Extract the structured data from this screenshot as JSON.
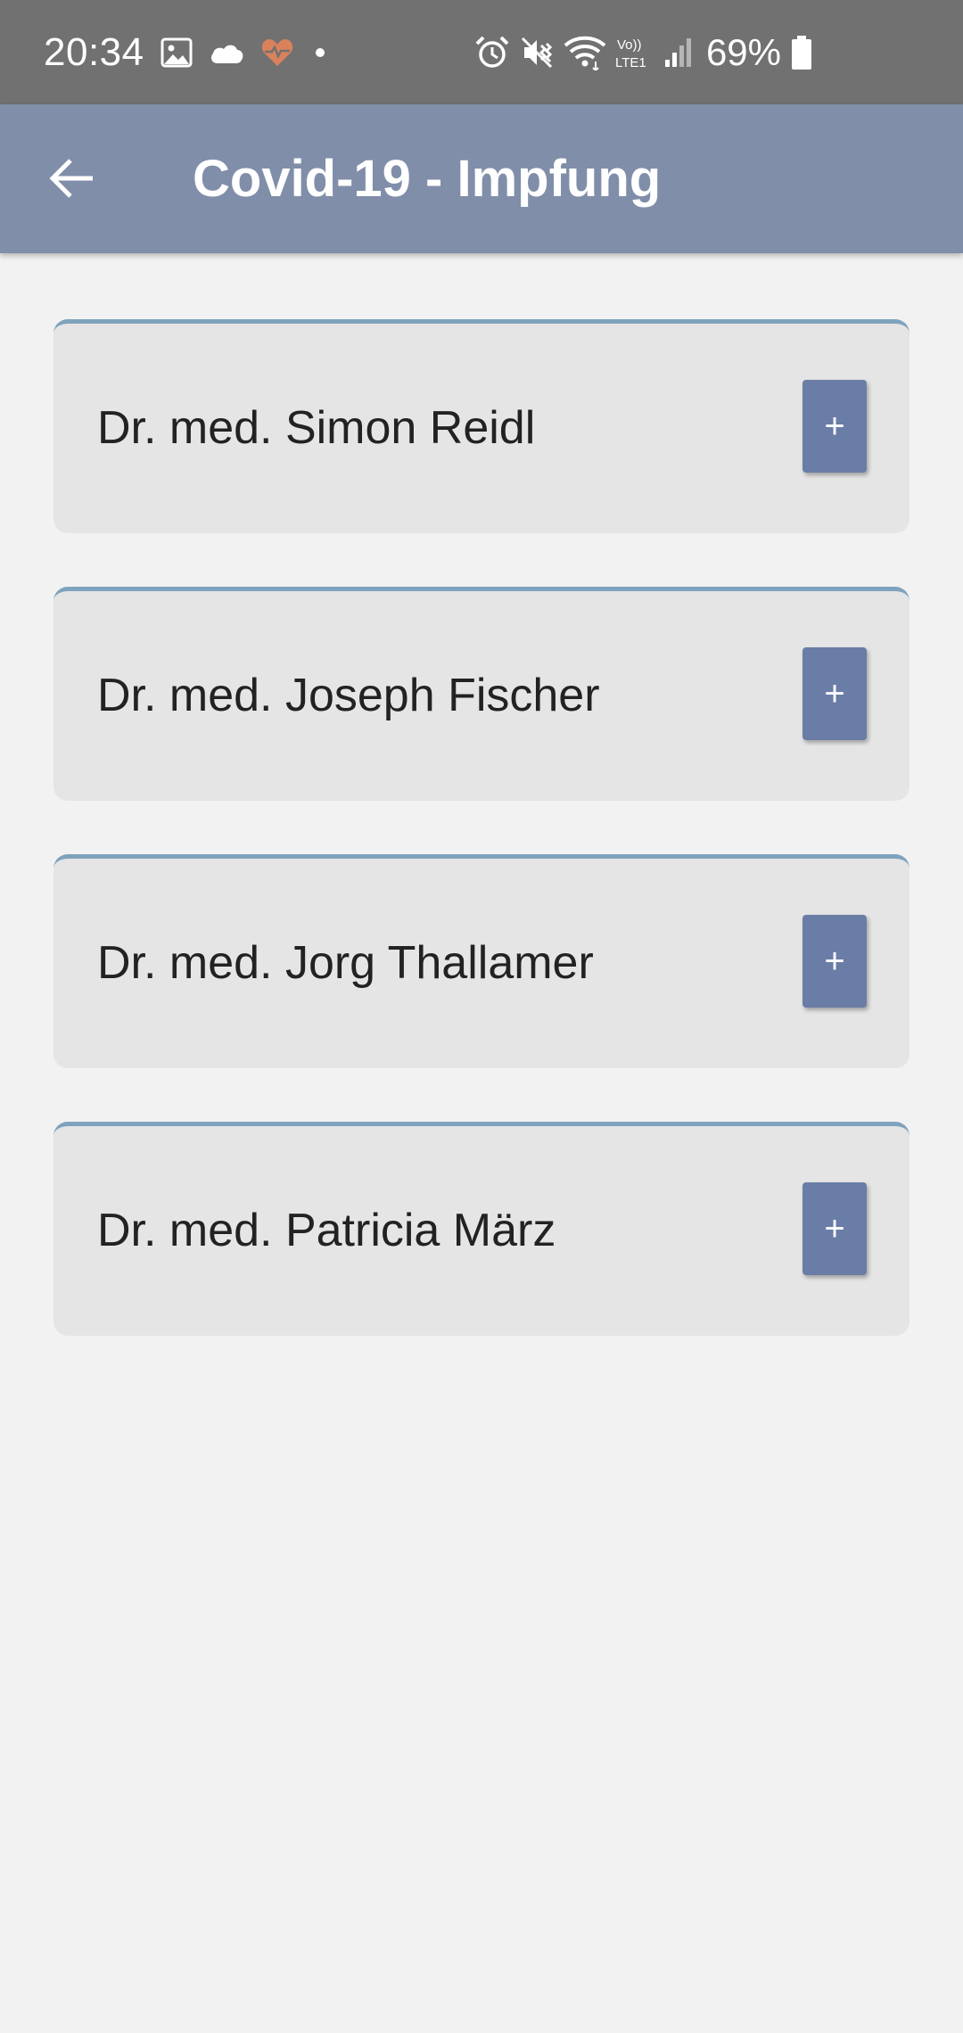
{
  "status_bar": {
    "time": "20:34",
    "battery_percent": "69%",
    "left_icons": [
      "gallery-icon",
      "cloud-icon",
      "health-heart-icon",
      "notification-dot-icon"
    ],
    "right_icons": [
      "alarm-icon",
      "vibrate-mute-icon",
      "wifi-icon",
      "volte-lte1-icon",
      "signal-icon",
      "battery-icon"
    ],
    "volte_label": "Vo)) LTE1"
  },
  "app_bar": {
    "title": "Covid-19 - Impfung",
    "back_icon": "arrow-left-icon"
  },
  "doctors": [
    {
      "name": "Dr. med. Simon Reidl",
      "action_label": "+"
    },
    {
      "name": "Dr. med. Joseph Fischer",
      "action_label": "+"
    },
    {
      "name": "Dr. med. Jorg Thallamer",
      "action_label": "+"
    },
    {
      "name": "Dr. med. Patricia März",
      "action_label": "+"
    }
  ],
  "colors": {
    "status_bar": "#717171",
    "app_bar": "#808ea9",
    "background": "#f2f2f2",
    "card": "#e5e5e5",
    "card_accent": "#7fa3bd",
    "add_button": "#6a7da6",
    "heart_icon": "#d9825b"
  }
}
